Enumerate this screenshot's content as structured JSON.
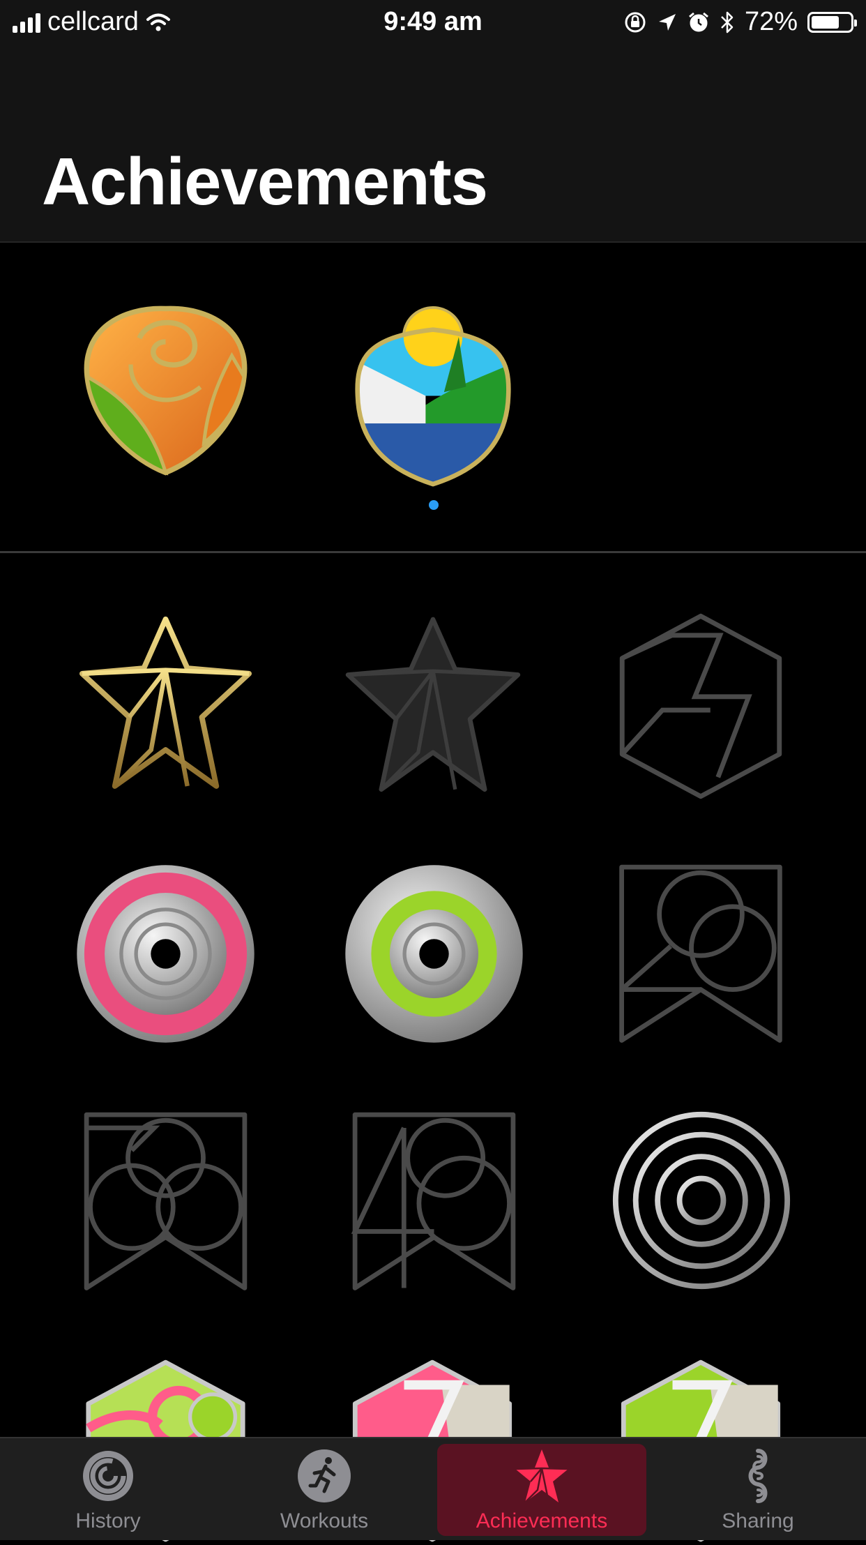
{
  "status_bar": {
    "carrier": "cellcard",
    "time": "9:49 am",
    "battery_percent": "72%",
    "battery_level": 0.72
  },
  "header": {
    "title": "Achievements"
  },
  "featured": {
    "badges": [
      {
        "name": "rose-badge-icon",
        "colors": [
          "#f08a20",
          "#6fb81e",
          "#b7a24a"
        ]
      },
      {
        "name": "landscape-badge-icon",
        "colors": [
          "#ffd21a",
          "#37c2ef",
          "#239a2a",
          "#2a5aa8"
        ]
      }
    ],
    "page_indicator_color": "#2a9df4"
  },
  "grid": {
    "badges": [
      {
        "name": "gold-star-icon",
        "earned": true
      },
      {
        "name": "dark-star-icon",
        "earned": false
      },
      {
        "name": "hexagon-outline-icon",
        "earned": false
      },
      {
        "name": "pink-ring-badge-icon",
        "earned": true
      },
      {
        "name": "green-ring-badge-icon",
        "earned": true
      },
      {
        "name": "twenty-badge-outline-icon",
        "earned": false
      },
      {
        "name": "thirty-badge-outline-icon",
        "earned": false
      },
      {
        "name": "forty-badge-outline-icon",
        "earned": false
      },
      {
        "name": "silver-rings-badge-icon",
        "earned": true
      },
      {
        "name": "green-pink-hexagon-badge-icon",
        "earned": true
      },
      {
        "name": "pink-hexagon-badge-icon",
        "earned": true
      },
      {
        "name": "green-hexagon-badge-icon",
        "earned": true
      }
    ]
  },
  "tabs": [
    {
      "label": "History",
      "icon": "history-rings-icon",
      "active": false
    },
    {
      "label": "Workouts",
      "icon": "runner-icon",
      "active": false
    },
    {
      "label": "Achievements",
      "icon": "star-icon",
      "active": true
    },
    {
      "label": "Sharing",
      "icon": "sharing-icon",
      "active": false
    }
  ],
  "colors": {
    "accent": "#ff2d55",
    "active_tab_bg": "#5a1222",
    "inactive": "#8e8e93"
  }
}
